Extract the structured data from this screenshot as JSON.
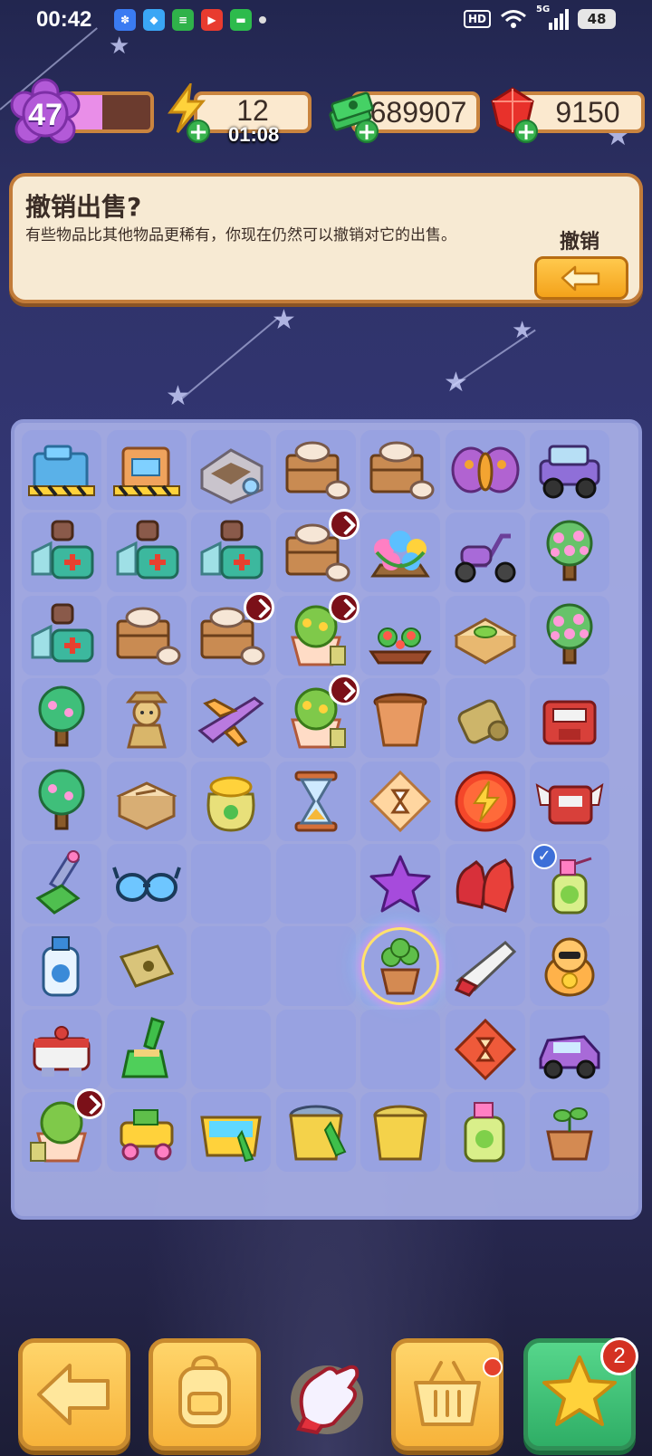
{
  "status_bar": {
    "time": "00:42",
    "hd": "HD",
    "network": "5G",
    "battery": "48"
  },
  "player": {
    "level": "47",
    "xp_progress": 0.42
  },
  "resources": {
    "energy": "12",
    "energy_timer": "01:08",
    "cash": "689907",
    "gems": "9150"
  },
  "dialog": {
    "title": "撤销出售?",
    "description": "有些物品比其他物品更稀有，你现在仍然可以撤销对它的出售。",
    "undo_label": "撤销"
  },
  "board": {
    "rows": [
      [
        "construction-site",
        "shop-construction",
        "crafting-table",
        "cargo-crate",
        "cargo-crate",
        "moth",
        "jeep"
      ],
      [
        "medical-kit",
        "medical-kit",
        "medical-kit",
        "cargo-crate-ship",
        "flower-bouquet",
        "scooter",
        "blossom-tree"
      ],
      [
        "medical-kit",
        "cargo-crate",
        "cargo-crate-ship",
        "flower-pot-ship",
        "flower-bed",
        "sandwich",
        "blossom-tree"
      ],
      [
        "green-tree",
        "scarecrow",
        "airplane",
        "flower-pot-ship",
        "clay-pot",
        "rolled-rug",
        "toolbox-red"
      ],
      [
        "green-tree",
        "wooden-box",
        "seed-bag-gold",
        "hourglass",
        "timer-token",
        "energy-coin",
        "toolbox-wings"
      ],
      [
        "scrub-brush",
        "sunglasses",
        "",
        "",
        "purple-star",
        "red-gloves",
        "spray-bottle-checked"
      ],
      [
        "water-bottle",
        "seed-packet",
        "",
        "",
        "potted-plant-rainbow",
        "hand-saw",
        "lucky-cat"
      ],
      [
        "robot-box",
        "green-broom",
        "",
        "",
        "",
        "timer-token-red",
        "purple-car"
      ],
      [
        "potted-bush-ship",
        "toy-cart",
        "aquarium",
        "bucket-full",
        "bucket",
        "detergent",
        "sprout-pot"
      ]
    ]
  },
  "bottom_bar": {
    "back_icon": "arrow-left-icon",
    "bag_icon": "backpack-icon",
    "glove_icon": "glove-icon",
    "shop_icon": "basket-icon",
    "star_icon": "star-icon",
    "star_count": "2"
  },
  "colors": {
    "accent": "#f4a21a",
    "panel": "#f7ead3",
    "board": "#acb4eb"
  }
}
